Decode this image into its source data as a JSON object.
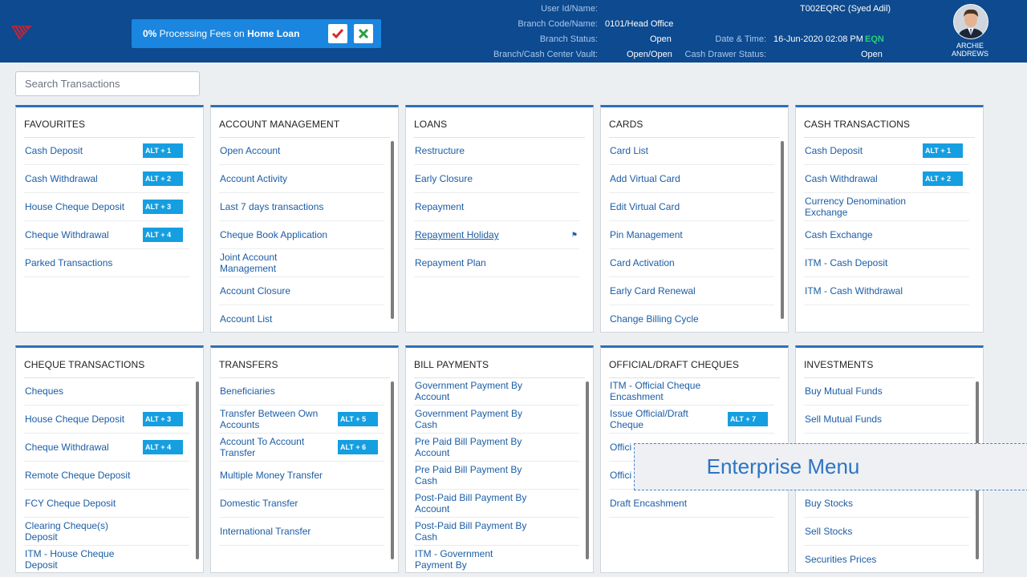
{
  "banner": {
    "prefix": "0%",
    "middle": " Processing Fees on ",
    "emph": "Home Loan"
  },
  "header": {
    "user_id_label": "User Id/Name:",
    "user_id_value": "T002EQRC (Syed Adil)",
    "branch_code_label": "Branch Code/Name:",
    "branch_code_value": "0101/Head Office",
    "branch_status_label": "Branch Status:",
    "branch_status_value": "Open",
    "vault_label": "Branch/Cash Center Vault:",
    "vault_value": "Open/Open",
    "datetime_label": "Date & Time:",
    "datetime_value": "16-Jun-2020 02:08 PM",
    "eqn": "EQN",
    "drawer_label": "Cash Drawer Status:",
    "drawer_value": "Open",
    "user_first": "ARCHIE",
    "user_last": "ANDREWS"
  },
  "search": {
    "placeholder": "Search Transactions"
  },
  "overlay": {
    "label": "Enterprise Menu"
  },
  "colors": {
    "header_bg": "#0d4a8f",
    "banner_bg": "#1a86e0",
    "shortcut_bg": "#159ee0",
    "link": "#1b5da6",
    "card_top_border": "#2f6fb6"
  },
  "cards": [
    {
      "title": "FAVOURITES",
      "items": [
        {
          "label": "Cash Deposit",
          "shortcut": "ALT + 1"
        },
        {
          "label": "Cash Withdrawal",
          "shortcut": "ALT + 2"
        },
        {
          "label": "House Cheque Deposit",
          "shortcut": "ALT + 3"
        },
        {
          "label": "Cheque Withdrawal",
          "shortcut": "ALT + 4"
        },
        {
          "label": "Parked Transactions"
        }
      ]
    },
    {
      "title": "ACCOUNT MANAGEMENT",
      "items": [
        {
          "label": "Open Account"
        },
        {
          "label": "Account Activity"
        },
        {
          "label": "Last 7 days transactions"
        },
        {
          "label": "Cheque Book Application"
        },
        {
          "label": "Joint Account Management"
        },
        {
          "label": "Account Closure"
        },
        {
          "label": "Account List"
        }
      ]
    },
    {
      "title": "LOANS",
      "items": [
        {
          "label": "Restructure"
        },
        {
          "label": "Early Closure"
        },
        {
          "label": "Repayment"
        },
        {
          "label": "Repayment Holiday",
          "pin": true
        },
        {
          "label": "Repayment Plan"
        }
      ]
    },
    {
      "title": "CARDS",
      "items": [
        {
          "label": "Card List"
        },
        {
          "label": "Add Virtual Card"
        },
        {
          "label": "Edit Virtual Card"
        },
        {
          "label": "Pin Management"
        },
        {
          "label": "Card Activation"
        },
        {
          "label": "Early Card Renewal"
        },
        {
          "label": "Change Billing Cycle"
        }
      ]
    },
    {
      "title": "CASH TRANSACTIONS",
      "items": [
        {
          "label": "Cash Deposit",
          "shortcut": "ALT + 1"
        },
        {
          "label": "Cash Withdrawal",
          "shortcut": "ALT + 2"
        },
        {
          "label": "Currency Denomination Exchange"
        },
        {
          "label": "Cash Exchange"
        },
        {
          "label": "ITM - Cash Deposit"
        },
        {
          "label": "ITM - Cash Withdrawal"
        }
      ]
    },
    {
      "title": "CHEQUE TRANSACTIONS",
      "items": [
        {
          "label": "Cheques"
        },
        {
          "label": "House Cheque Deposit",
          "shortcut": "ALT + 3"
        },
        {
          "label": "Cheque Withdrawal",
          "shortcut": "ALT + 4"
        },
        {
          "label": "Remote Cheque Deposit"
        },
        {
          "label": "FCY Cheque Deposit"
        },
        {
          "label": "Clearing Cheque(s) Deposit"
        },
        {
          "label": "ITM - House Cheque Deposit"
        }
      ]
    },
    {
      "title": "TRANSFERS",
      "items": [
        {
          "label": "Beneficiaries"
        },
        {
          "label": "Transfer Between Own Accounts",
          "shortcut": "ALT + 5"
        },
        {
          "label": "Account To Account Transfer",
          "shortcut": "ALT + 6"
        },
        {
          "label": "Multiple Money Transfer"
        },
        {
          "label": "Domestic Transfer"
        },
        {
          "label": "International Transfer"
        }
      ]
    },
    {
      "title": "BILL PAYMENTS",
      "items": [
        {
          "label": "Government Payment By Account"
        },
        {
          "label": "Government Payment By Cash"
        },
        {
          "label": "Pre Paid Bill Payment By Account"
        },
        {
          "label": "Pre Paid Bill Payment By Cash"
        },
        {
          "label": "Post-Paid Bill Payment By Account"
        },
        {
          "label": "Post-Paid Bill Payment By Cash"
        },
        {
          "label": "ITM - Government Payment By"
        }
      ]
    },
    {
      "title": "OFFICIAL/DRAFT CHEQUES",
      "items": [
        {
          "label": "ITM - Official Cheque Encashment"
        },
        {
          "label": "Issue Official/Draft Cheque",
          "shortcut": "ALT + 7"
        },
        {
          "label": "Offici"
        },
        {
          "label": "Offici"
        },
        {
          "label": "Draft Encashment"
        }
      ]
    },
    {
      "title": "INVESTMENTS",
      "items": [
        {
          "label": "Buy Mutual Funds"
        },
        {
          "label": "Sell Mutual Funds"
        },
        {
          "label": ""
        },
        {
          "label": ""
        },
        {
          "label": "Buy Stocks"
        },
        {
          "label": "Sell Stocks"
        },
        {
          "label": "Securities Prices"
        }
      ]
    }
  ]
}
